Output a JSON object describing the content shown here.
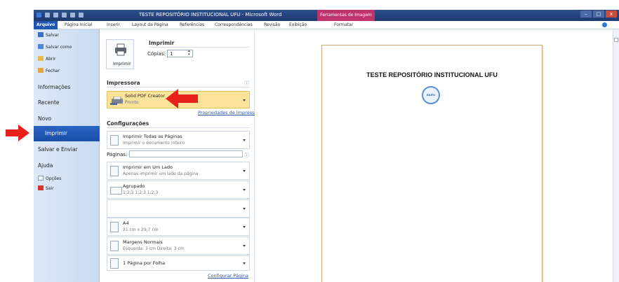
{
  "window": {
    "title": "TESTE REPOSITÓRIO INSTITUCIONAL UFU - Microsoft Word",
    "context_tab": "Ferramentas de Imagem"
  },
  "ribbon": {
    "tabs": [
      "Arquivo",
      "Página Inicial",
      "Inserir",
      "Layout da Página",
      "Referências",
      "Correspondências",
      "Revisão",
      "Exibição",
      "Formatar"
    ]
  },
  "nav": {
    "small_top": [
      "Salvar",
      "Salvar como",
      "Abrir",
      "Fechar"
    ],
    "informacoes": "Informações",
    "recente": "Recente",
    "novo": "Novo",
    "imprimir": "Imprimir",
    "salvar_enviar": "Salvar e Enviar",
    "ajuda": "Ajuda",
    "opcoes": "Opções",
    "sair": "Sair"
  },
  "print": {
    "heading": "Imprimir",
    "button_label": "Imprimir",
    "copies_label": "Cópias:",
    "copies_value": "1"
  },
  "printer": {
    "section": "Impressora",
    "name": "Solid PDF Creator",
    "status": "Pronto",
    "properties_link": "Propriedades de Impressora"
  },
  "settings": {
    "section": "Configurações",
    "pages_label": "Páginas:",
    "pages_value": "",
    "setup_link": "Configurar Página",
    "options": [
      {
        "title": "Imprimir Todas as Páginas",
        "sub": "Imprimir o documento inteiro"
      },
      {
        "title": "Imprimir em Um Lado",
        "sub": "Apenas imprimir um lado da página"
      },
      {
        "title": "Agrupado",
        "sub": "1;2;3   1;2;3   1;2;3"
      },
      {
        "title": "",
        "sub": ""
      },
      {
        "title": "A4",
        "sub": "21 cm x 29,7 cm"
      },
      {
        "title": "Margens Normais",
        "sub": "Esquerda: 3 cm   Direita: 3 cm"
      },
      {
        "title": "1 Página por Folha",
        "sub": ""
      }
    ]
  },
  "preview": {
    "document_title": "TESTE REPOSITÓRIO INSTITUCIONAL UFU",
    "seal_text": "RIUFU"
  },
  "colors": {
    "accent": "#1e56b0",
    "printer_highlight": "#fbe39a",
    "arrow": "#e8211d",
    "context_tab": "#c0346c"
  }
}
